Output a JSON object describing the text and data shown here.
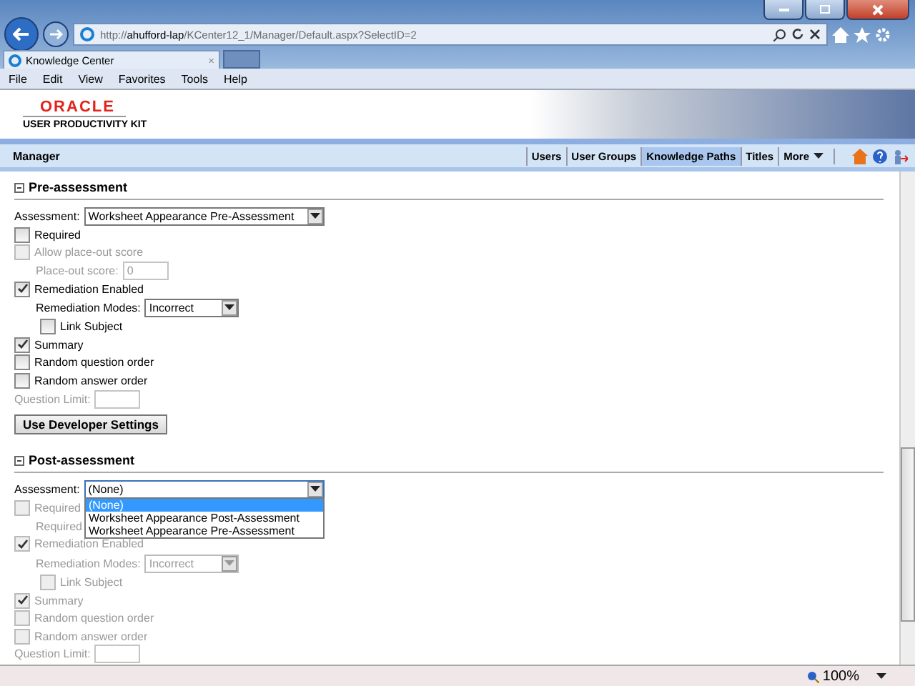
{
  "browser": {
    "url_scheme": "http://",
    "url_host": "ahufford-lap",
    "url_path": "/KCenter12_1/Manager/Default.aspx?SelectID=2",
    "tab_title": "Knowledge Center",
    "tab_close": "×",
    "menu": [
      "File",
      "Edit",
      "View",
      "Favorites",
      "Tools",
      "Help"
    ],
    "zoom": "100%"
  },
  "header": {
    "logo": "ORACLE",
    "product": "USER PRODUCTIVITY KIT"
  },
  "nav": {
    "title": "Manager",
    "links": [
      {
        "label": "Users",
        "selected": false
      },
      {
        "label": "User Groups",
        "selected": false
      },
      {
        "label": "Knowledge Paths",
        "selected": true
      },
      {
        "label": "Titles",
        "selected": false
      },
      {
        "label": "More",
        "selected": false,
        "menu": true
      }
    ]
  },
  "sections": [
    {
      "title": "Pre-assessment",
      "expanded": true,
      "assessment_label": "Assessment:",
      "assessment": "Worksheet Appearance Pre-Assessment",
      "open": false,
      "items": [
        {
          "kind": "checkbox",
          "label": "Required",
          "checked": false,
          "disabled": false
        },
        {
          "kind": "checkbox",
          "label": "Allow place-out score",
          "checked": false,
          "disabled": true,
          "children": [
            {
              "kind": "field",
              "label": "Place-out score:",
              "value": "0",
              "disabled": true
            }
          ]
        },
        {
          "kind": "checkbox",
          "label": "Remediation Enabled",
          "checked": true,
          "disabled": false,
          "children": [
            {
              "kind": "select",
              "label": "Remediation Modes:",
              "value": "Incorrect",
              "disabled": false,
              "children": [
                {
                  "kind": "checkbox",
                  "label": "Link Subject",
                  "checked": false,
                  "disabled": false
                }
              ]
            }
          ]
        },
        {
          "kind": "checkbox",
          "label": "Summary",
          "checked": true,
          "disabled": false
        },
        {
          "kind": "checkbox",
          "label": "Random question order",
          "checked": false,
          "disabled": false
        },
        {
          "kind": "checkbox",
          "label": "Random answer order",
          "checked": false,
          "disabled": false
        },
        {
          "kind": "field",
          "label": "Question Limit:",
          "value": "",
          "disabled": true
        }
      ],
      "button": "Use Developer Settings"
    },
    {
      "title": "Post-assessment",
      "expanded": true,
      "assessment_label": "Assessment:",
      "assessment": "(None)",
      "open": true,
      "options": [
        {
          "label": "(None)",
          "selected": true
        },
        {
          "label": "Worksheet Appearance Post-Assessment",
          "selected": false
        },
        {
          "label": "Worksheet Appearance Pre-Assessment",
          "selected": false
        }
      ],
      "items": [
        {
          "kind": "checkbox",
          "label": "Required",
          "checked": false,
          "disabled": true,
          "children": [
            {
              "kind": "label",
              "label": "Required",
              "disabled": true
            }
          ]
        },
        {
          "kind": "checkbox",
          "label": "Remediation Enabled",
          "checked": true,
          "disabled": true,
          "children": [
            {
              "kind": "select",
              "label": "Remediation Modes:",
              "value": "Incorrect",
              "disabled": true,
              "children": [
                {
                  "kind": "checkbox",
                  "label": "Link Subject",
                  "checked": false,
                  "disabled": true
                }
              ]
            }
          ]
        },
        {
          "kind": "checkbox",
          "label": "Summary",
          "checked": true,
          "disabled": true
        },
        {
          "kind": "checkbox",
          "label": "Random question order",
          "checked": false,
          "disabled": true
        },
        {
          "kind": "checkbox",
          "label": "Random answer order",
          "checked": false,
          "disabled": true
        },
        {
          "kind": "field",
          "label": "Question Limit:",
          "value": "",
          "disabled": true
        }
      ]
    }
  ]
}
